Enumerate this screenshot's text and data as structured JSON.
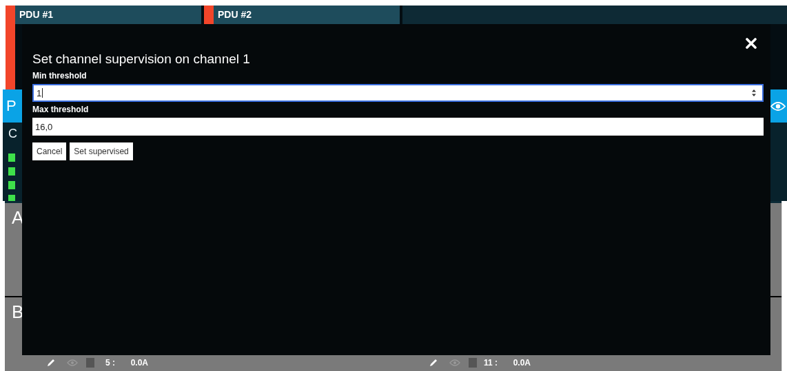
{
  "pdus": [
    {
      "name": "PDU #1",
      "alarm": true
    },
    {
      "name": "PDU #2",
      "alarm": true
    }
  ],
  "section": {
    "title": "P"
  },
  "current": {
    "heading": "C",
    "phases": [
      {
        "ok": true
      },
      {
        "ok": true
      },
      {
        "ok": true
      },
      {
        "ok": true
      }
    ]
  },
  "groups": [
    {
      "letter": "A"
    },
    {
      "letter": "B",
      "columns": [
        [
          {
            "number": "5 :",
            "current": "0.0A",
            "color": "#555555"
          }
        ],
        [
          {
            "number": "11 :",
            "current": "0.0A",
            "color": "#555555"
          }
        ]
      ]
    }
  ],
  "modal": {
    "title": "Set channel supervision on channel 1",
    "fields": [
      {
        "label": "Min threshold",
        "value": "1",
        "kind": "number",
        "focused": true
      },
      {
        "label": "Max threshold",
        "value": "16,0",
        "kind": "text",
        "focused": false
      }
    ],
    "buttons": [
      "Cancel",
      "Set supervised"
    ]
  }
}
